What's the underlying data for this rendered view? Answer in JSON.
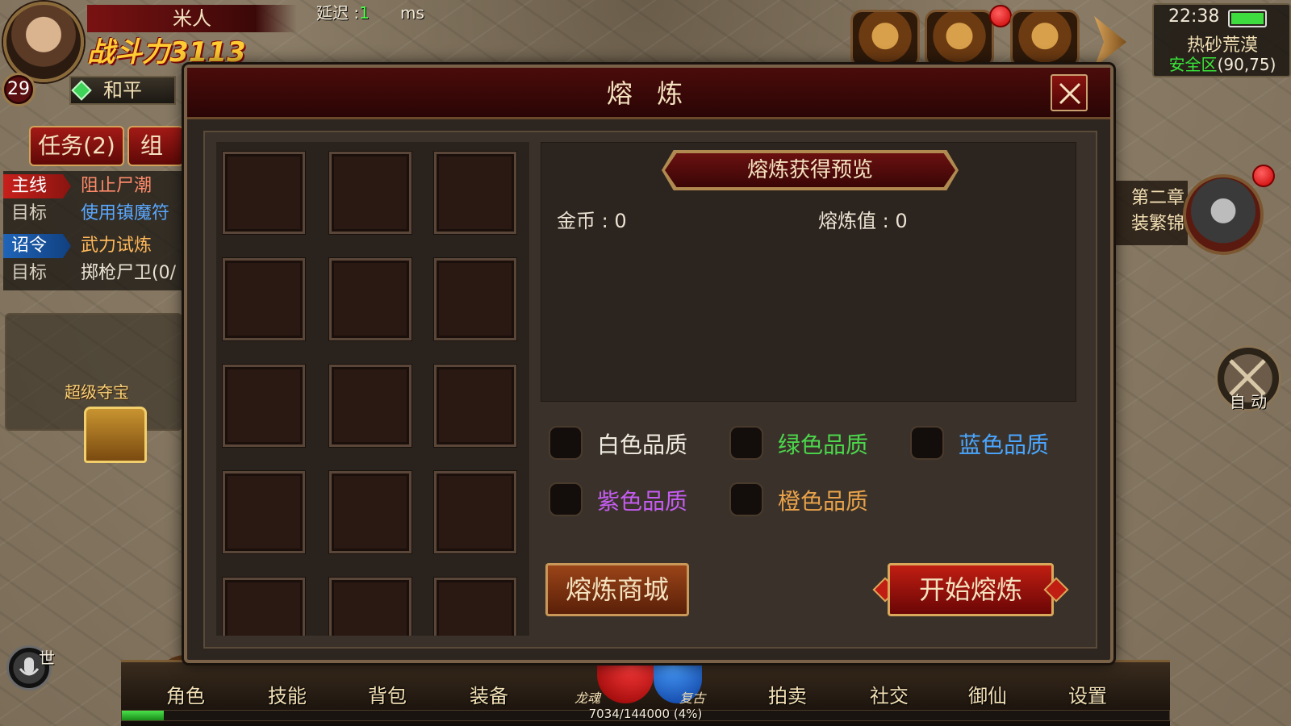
{
  "player": {
    "name": "米人",
    "level": "29",
    "power_label": "战斗力",
    "power_value": "3113",
    "mode": "和平"
  },
  "latency": {
    "label": "延迟 :",
    "value": "1",
    "unit": "ms"
  },
  "quest_tabs": {
    "tasks": "任务(2)",
    "team": "组"
  },
  "quests": [
    {
      "tag": "主线",
      "text": "阻止尸潮"
    },
    {
      "tag": "目标",
      "text": "使用镇魔符"
    },
    {
      "tag": "诏令",
      "text": "武力试炼"
    },
    {
      "tag": "目标",
      "text": "掷枪尸卫(0/"
    }
  ],
  "treasure_label": "超级夺宝",
  "status": {
    "time": "22:38",
    "zone": "热砂荒漠",
    "safe_zone": "安全区",
    "coords": "(90,75)"
  },
  "chapter": {
    "line1": "第二章",
    "line2": "装繁锦"
  },
  "auto_label": "自 动",
  "mic_label": "世",
  "dialog": {
    "title": "熔 炼",
    "preview_title": "熔炼获得预览",
    "gold_label": "金币 : 0",
    "smelt_label": "熔炼值 : 0",
    "qualities": [
      {
        "label": "白色品质",
        "color": "#f0ebe0"
      },
      {
        "label": "绿色品质",
        "color": "#4cd64c"
      },
      {
        "label": "蓝色品质",
        "color": "#4aa6ff"
      },
      {
        "label": "紫色品质",
        "color": "#c45cf0"
      },
      {
        "label": "橙色品质",
        "color": "#e8a24a"
      }
    ],
    "shop_button": "熔炼商城",
    "start_button": "开始熔炼"
  },
  "bottom_menu": [
    "角色",
    "技能",
    "背包",
    "装备",
    "拍卖",
    "社交",
    "御仙",
    "设置"
  ],
  "orb": {
    "left": "龙魂",
    "right": "复古"
  },
  "exp": {
    "text": "7034/144000 (4%)",
    "fraction": 0.04
  }
}
